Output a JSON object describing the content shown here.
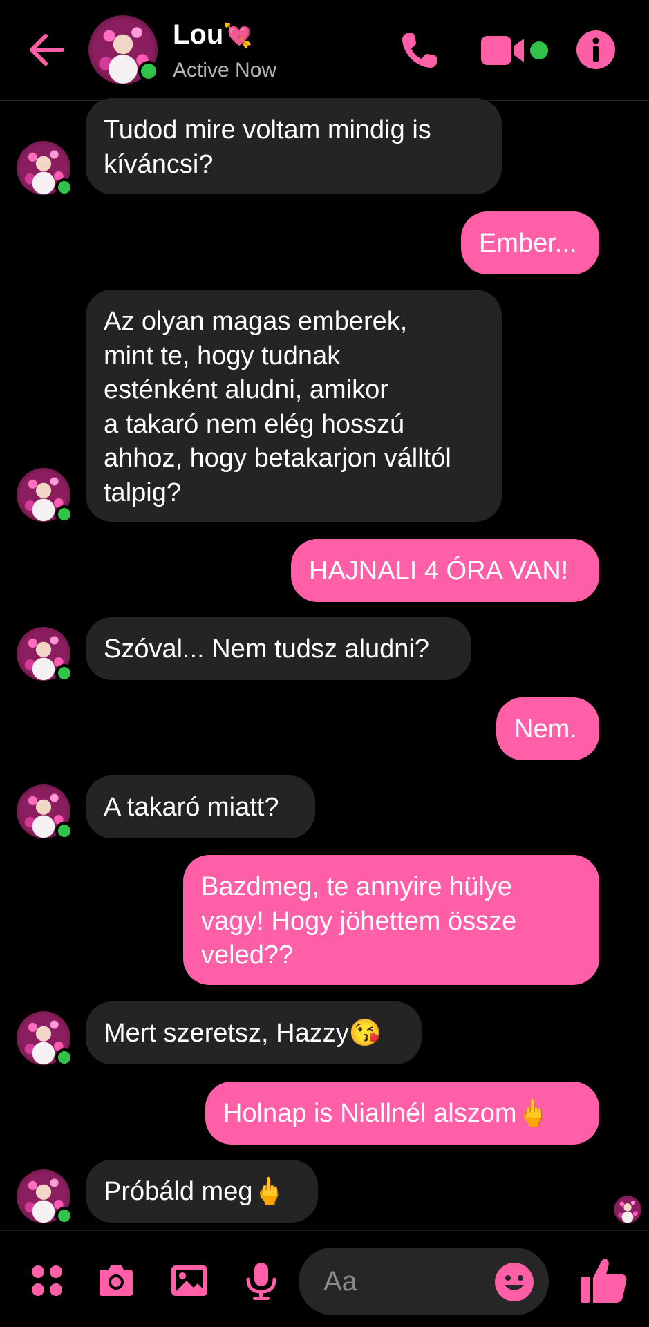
{
  "header": {
    "name": "Lou",
    "name_emoji": "💘",
    "status": "Active Now"
  },
  "colors": {
    "accent": "#ff5fa6",
    "incoming_bubble": "#242424",
    "online": "#31c24a",
    "background": "#000000"
  },
  "messages": [
    {
      "sender": "Lou",
      "direction": "incoming",
      "text": "Tudod mire voltam mindig is\nkíváncsi?"
    },
    {
      "sender": "me",
      "direction": "outgoing",
      "text": "Ember..."
    },
    {
      "sender": "Lou",
      "direction": "incoming",
      "text": "Az olyan magas emberek,\nmint te, hogy tudnak\nesténként aludni, amikor\na takaró nem elég hosszú\nahhoz, hogy betakarjon válltól\ntalpig?"
    },
    {
      "sender": "me",
      "direction": "outgoing",
      "text": "HAJNALI 4 ÓRA VAN!"
    },
    {
      "sender": "Lou",
      "direction": "incoming",
      "text": "Szóval... Nem tudsz aludni?"
    },
    {
      "sender": "me",
      "direction": "outgoing",
      "text": "Nem."
    },
    {
      "sender": "Lou",
      "direction": "incoming",
      "text": "A takaró miatt?"
    },
    {
      "sender": "me",
      "direction": "outgoing",
      "text": "Bazdmeg, te annyire hülye\nvagy! Hogy jöhettem össze\nveled??"
    },
    {
      "sender": "Lou",
      "direction": "incoming",
      "text": "Mert szeretsz, Hazzy😘"
    },
    {
      "sender": "me",
      "direction": "outgoing",
      "text": "Holnap is Niallnél alszom🖕"
    },
    {
      "sender": "Lou",
      "direction": "incoming",
      "text": "Próbáld meg🖕"
    }
  ],
  "composer": {
    "placeholder": "Aa",
    "icons": [
      "apps-icon",
      "camera-icon",
      "image-icon",
      "microphone-icon",
      "emoji-icon",
      "thumbs-up-icon"
    ]
  }
}
